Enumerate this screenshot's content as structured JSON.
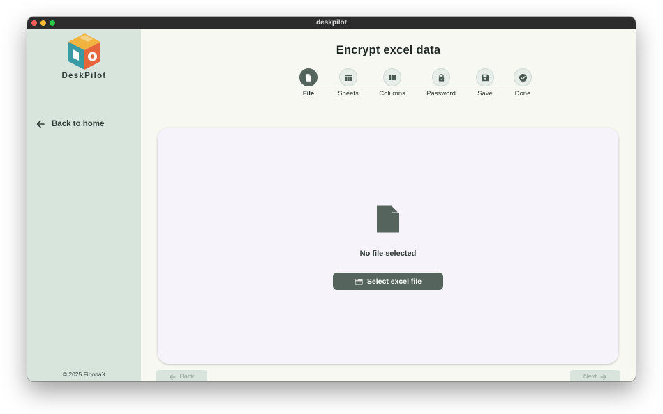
{
  "window": {
    "title": "deskpilot"
  },
  "sidebar": {
    "brand": "DeskPilot",
    "back_home_label": "Back to home",
    "copyright": "© 2025 FibonaX"
  },
  "page": {
    "title": "Encrypt excel data"
  },
  "steps": [
    {
      "label": "File",
      "icon": "file-icon",
      "active": true
    },
    {
      "label": "Sheets",
      "icon": "table-icon",
      "active": false
    },
    {
      "label": "Columns",
      "icon": "columns-icon",
      "active": false
    },
    {
      "label": "Password",
      "icon": "lock-icon",
      "active": false
    },
    {
      "label": "Save",
      "icon": "save-icon",
      "active": false
    },
    {
      "label": "Done",
      "icon": "check-circle-icon",
      "active": false
    }
  ],
  "card": {
    "empty_text": "No file selected",
    "select_button_label": "Select excel file"
  },
  "footer": {
    "back_label": "Back",
    "next_label": "Next"
  },
  "colors": {
    "sidebar_bg": "#d8e5dc",
    "accent": "#55655d",
    "card_bg": "#f6f3fb",
    "main_bg": "#f8f8f2"
  }
}
